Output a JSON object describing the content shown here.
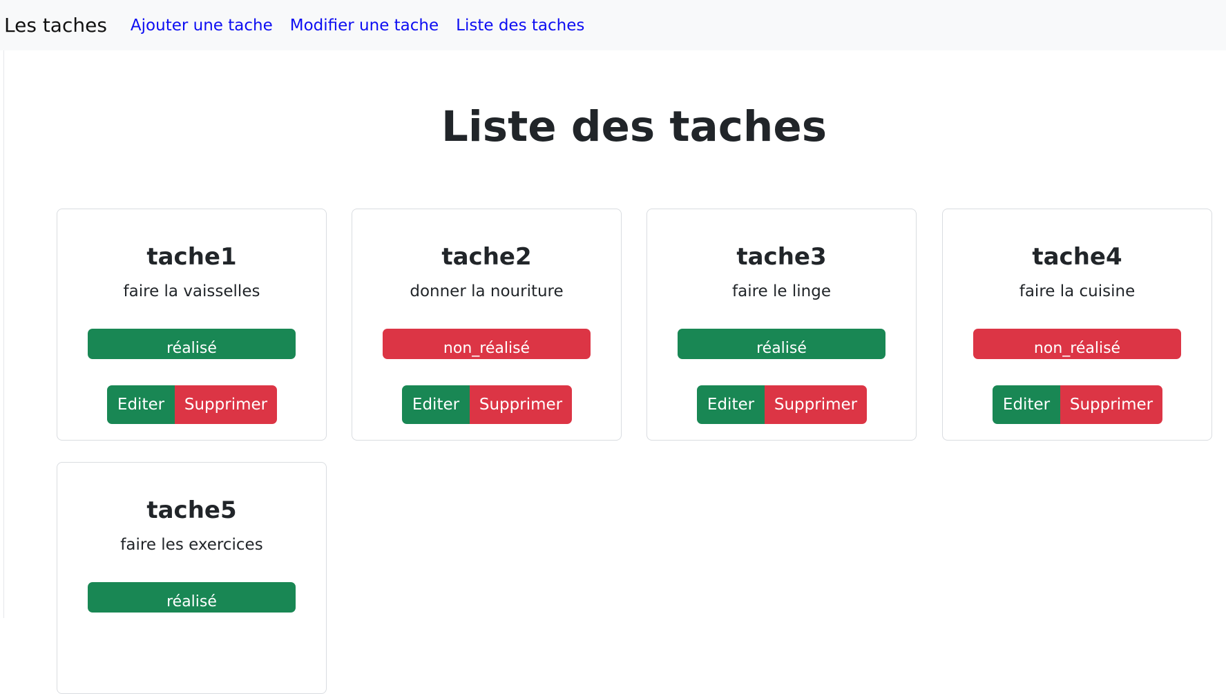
{
  "navbar": {
    "brand": "Les taches",
    "links": [
      "Ajouter une tache",
      "Modifier une tache",
      "Liste des taches"
    ]
  },
  "page": {
    "title": "Liste des taches"
  },
  "tasks": [
    {
      "title": "tache1",
      "description": "faire la vaisselles",
      "status": "réalisé",
      "edit_label": "Editer",
      "delete_label": "Supprimer"
    },
    {
      "title": "tache2",
      "description": "donner la nouriture",
      "status": "non_réalisé",
      "edit_label": "Editer",
      "delete_label": "Supprimer"
    },
    {
      "title": "tache3",
      "description": "faire le linge",
      "status": "réalisé",
      "edit_label": "Editer",
      "delete_label": "Supprimer"
    },
    {
      "title": "tache4",
      "description": "faire la cuisine",
      "status": "non_réalisé",
      "edit_label": "Editer",
      "delete_label": "Supprimer"
    },
    {
      "title": "tache5",
      "description": "faire les exercices",
      "status": "réalisé"
    }
  ],
  "colors": {
    "success": "#198754",
    "danger": "#dc3545",
    "link": "#0d0df2",
    "navbar_bg": "#f8f9fa"
  }
}
